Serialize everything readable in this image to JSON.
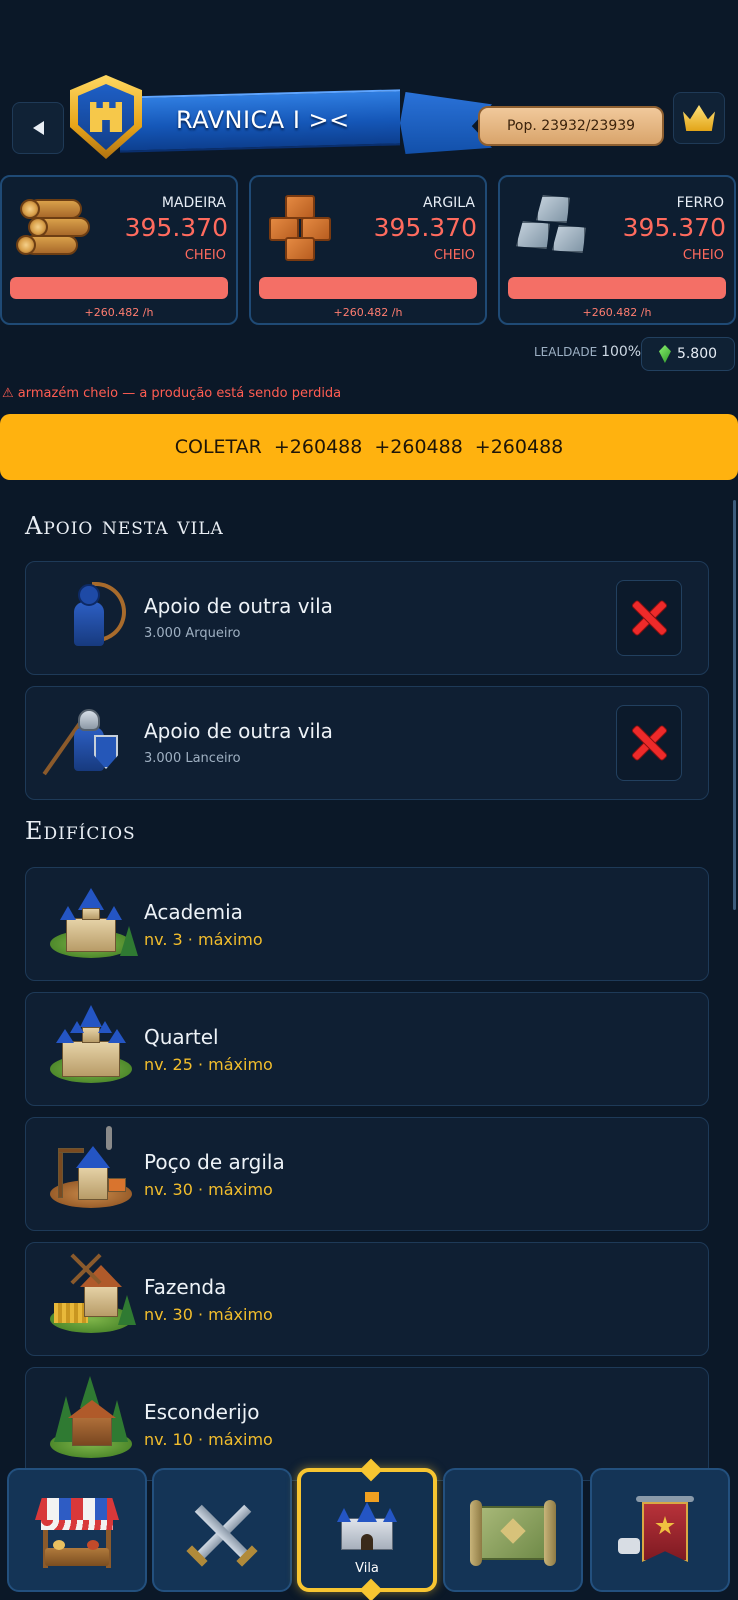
{
  "header": {
    "village_name": "RAVNICA I ><",
    "population": "Pop. 23932/23939"
  },
  "resources": [
    {
      "name": "MADEIRA",
      "amount": "395.370",
      "status": "CHEIO",
      "rate": "+260.482 /h",
      "fill": 1.0,
      "icon": "wood-logs-icon"
    },
    {
      "name": "ARGILA",
      "amount": "395.370",
      "status": "CHEIO",
      "rate": "+260.482 /h",
      "fill": 1.0,
      "icon": "clay-bricks-icon"
    },
    {
      "name": "FERRO",
      "amount": "395.370",
      "status": "CHEIO",
      "rate": "+260.482 /h",
      "fill": 1.0,
      "icon": "iron-ore-icon"
    }
  ],
  "loyalty": {
    "label": "LEALDADE",
    "value": "100%"
  },
  "gems": "5.800",
  "warning": "⚠ armazém cheio — a produção está sendo perdida",
  "collect": {
    "label": "COLETAR",
    "amounts": [
      "+260488",
      "+260488",
      "+260488"
    ]
  },
  "support": {
    "title": "Apoio nesta vila",
    "items": [
      {
        "title": "Apoio de outra vila",
        "subtitle": "3.000 Arqueiro",
        "icon": "archer-icon"
      },
      {
        "title": "Apoio de outra vila",
        "subtitle": "3.000 Lanceiro",
        "icon": "spearman-icon"
      }
    ]
  },
  "buildings": {
    "title": "Edifícios",
    "items": [
      {
        "name": "Academia",
        "level": "nv. 3 · máximo",
        "icon": "academy-icon"
      },
      {
        "name": "Quartel",
        "level": "nv. 25 · máximo",
        "icon": "barracks-icon"
      },
      {
        "name": "Poço de argila",
        "level": "nv. 30 · máximo",
        "icon": "clay-pit-icon"
      },
      {
        "name": "Fazenda",
        "level": "nv. 30 · máximo",
        "icon": "farm-icon"
      },
      {
        "name": "Esconderijo",
        "level": "nv. 10 · máximo",
        "icon": "hideout-icon"
      }
    ]
  },
  "nav": [
    {
      "icon": "market-stall-icon",
      "label": ""
    },
    {
      "icon": "crossed-swords-icon",
      "label": ""
    },
    {
      "icon": "castle-icon",
      "label": "Vila",
      "active": true
    },
    {
      "icon": "map-scroll-icon",
      "label": ""
    },
    {
      "icon": "tribe-banner-icon",
      "label": ""
    }
  ],
  "colors": {
    "accent": "#ffb20f",
    "full_resource": "#ff6b5e",
    "max_level": "#f2bd2c",
    "background": "#0b1828"
  }
}
